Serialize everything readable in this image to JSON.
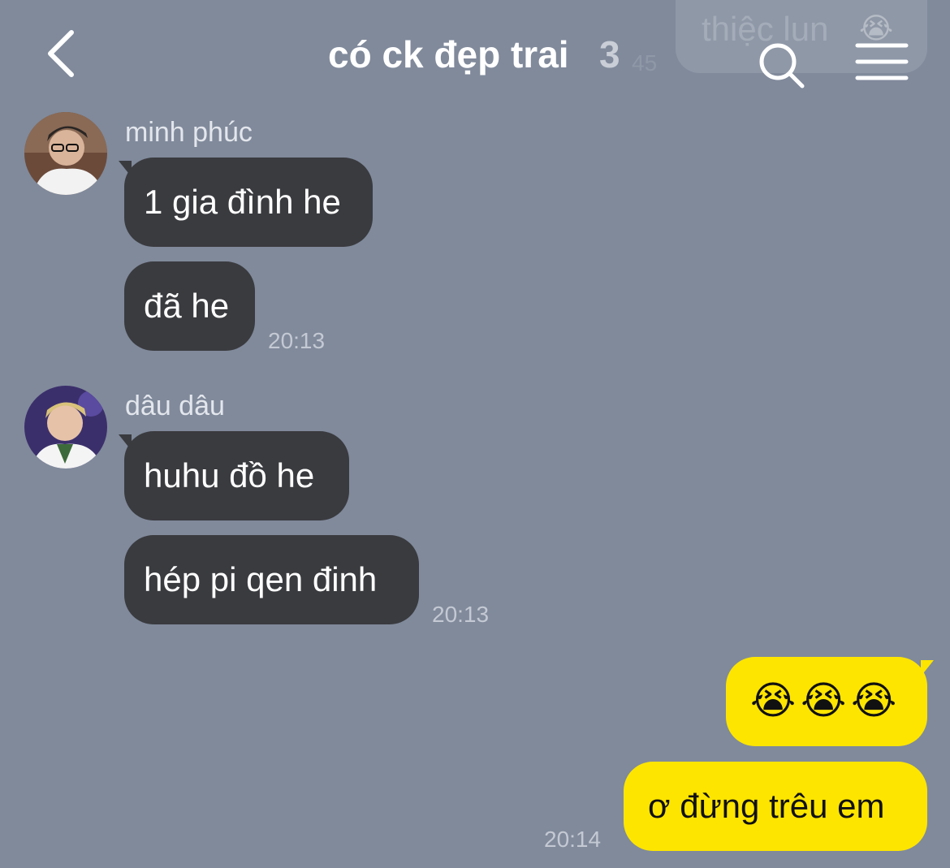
{
  "header": {
    "title": "có ck đẹp trai",
    "member_count": "3",
    "back_icon": "chevron-left-icon",
    "search_icon": "search-icon",
    "menu_icon": "hamburger-menu-icon"
  },
  "overlap_preview": {
    "text": "thiệc lun",
    "emoji": "😭",
    "time": "45"
  },
  "messages": [
    {
      "sender": "minh phúc",
      "bubbles": [
        "1 gia đình he",
        "đã he"
      ],
      "time": "20:13"
    },
    {
      "sender": "dâu dâu",
      "bubbles": [
        "huhu đồ he",
        "hép pi qen đinh"
      ],
      "time": "20:13"
    }
  ],
  "outgoing": {
    "bubbles": [
      "😭😭😭",
      "ơ đừng trêu em"
    ],
    "time": "20:14"
  },
  "colors": {
    "background": "#808a9b",
    "incoming_bubble": "#3a3b3f",
    "outgoing_bubble": "#fee500"
  }
}
